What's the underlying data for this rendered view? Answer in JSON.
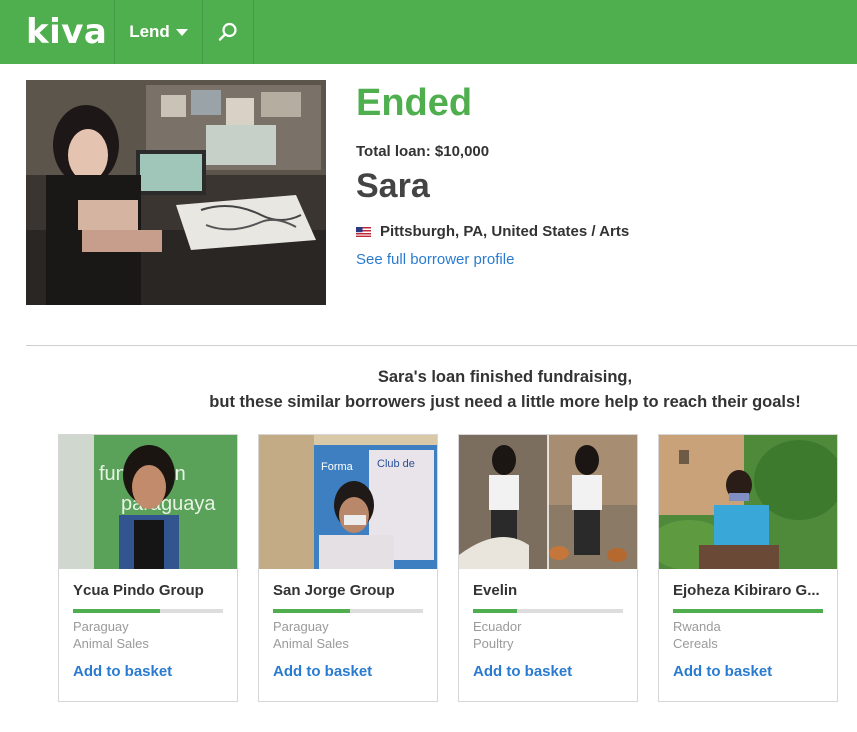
{
  "header": {
    "logo": "kiva",
    "nav_lend": "Lend",
    "brand_color": "#4faf4e"
  },
  "borrower": {
    "status": "Ended",
    "total_loan": "Total loan: $10,000",
    "name": "Sara",
    "location": "Pittsburgh, PA, United States / Arts",
    "profile_link": "See full borrower profile"
  },
  "message": {
    "line1": "Sara's loan finished fundraising,",
    "line2": "but these similar borrowers just need a little more help to reach their goals!"
  },
  "cards": [
    {
      "name": "Ycua Pindo Group",
      "country": "Paraguay",
      "sector": "Animal Sales",
      "progress": 0.58,
      "action": "Add to basket"
    },
    {
      "name": "San Jorge Group",
      "country": "Paraguay",
      "sector": "Animal Sales",
      "progress": 0.51,
      "action": "Add to basket"
    },
    {
      "name": "Evelin",
      "country": "Ecuador",
      "sector": "Poultry",
      "progress": 0.29,
      "action": "Add to basket"
    },
    {
      "name": "Ejoheza Kibiraro G...",
      "country": "Rwanda",
      "sector": "Cereals",
      "progress": 1.0,
      "action": "Add to basket"
    }
  ]
}
